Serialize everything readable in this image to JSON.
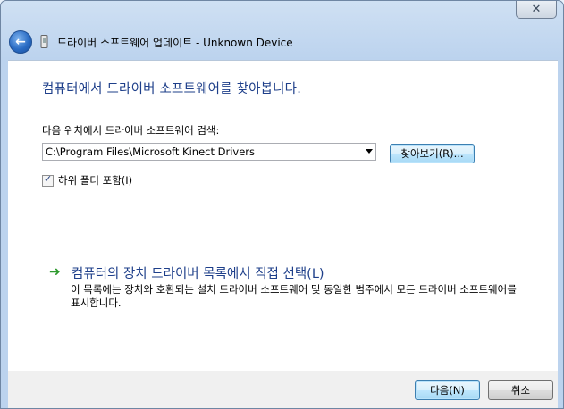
{
  "window": {
    "title": "드라이버 소프트웨어 업데이트 - Unknown Device",
    "close_glyph": "✕"
  },
  "nav": {
    "back_glyph": "←"
  },
  "main": {
    "heading": "컴퓨터에서 드라이버 소프트웨어를 찾아봅니다.",
    "search_label": "다음 위치에서 드라이버 소프트웨어 검색:",
    "path_value": "C:\\Program Files\\Microsoft Kinect Drivers",
    "browse_label": "찾아보기(R)...",
    "subfolder_label": "하위 폴더 포함(I)",
    "subfolder_checked": true,
    "pick_arrow": "➔",
    "pick_title": "컴퓨터의 장치 드라이버 목록에서 직접 선택(L)",
    "pick_description": "이 목록에는 장치와 호환되는 설치 드라이버 소프트웨어 및 동일한 범주에서 모든 드라이버 소프트웨어를 표시합니다."
  },
  "footer": {
    "next_label": "다음(N)",
    "cancel_label": "취소"
  },
  "colors": {
    "heading": "#1e3f8a",
    "link_arrow": "#2e9a2e"
  }
}
